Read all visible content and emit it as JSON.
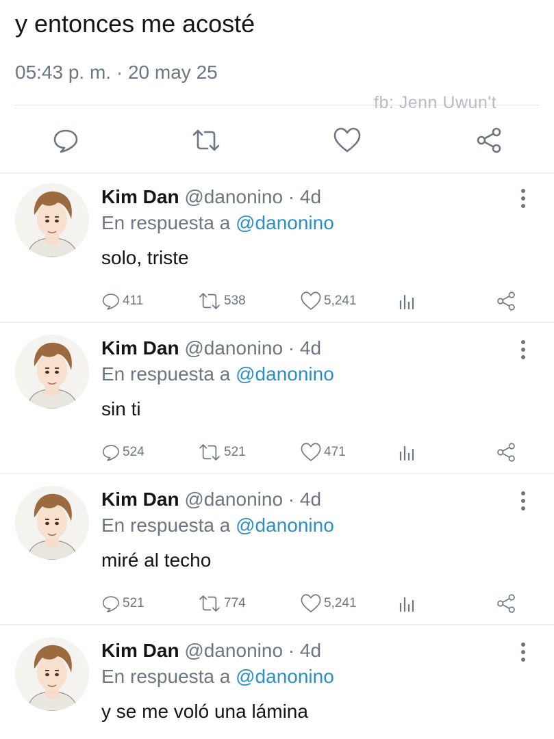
{
  "tweet": {
    "text": "y entonces me acosté",
    "meta": "05:43 p. m. · 20 may 25",
    "watermark": "fb: Jenn Uwun't",
    "actions": [
      "reply-icon",
      "retweet-icon",
      "like-icon",
      "share-icon"
    ]
  },
  "replies": [
    {
      "name": "Kim Dan",
      "handle": "@danonino · 4d",
      "reply_prefix": "En respuesta a ",
      "reply_mention": "@danonino",
      "text": "solo, triste",
      "replies": "411",
      "retweets": "538",
      "likes": "5,241"
    },
    {
      "name": "Kim Dan",
      "handle": "@danonino · 4d",
      "reply_prefix": "En respuesta a ",
      "reply_mention": "@danonino",
      "text": "sin ti",
      "replies": "524",
      "retweets": "521",
      "likes": "471"
    },
    {
      "name": "Kim Dan",
      "handle": "@danonino · 4d",
      "reply_prefix": "En respuesta a ",
      "reply_mention": "@danonino",
      "text": "miré al techo",
      "replies": "521",
      "retweets": "774",
      "likes": "5,241"
    },
    {
      "name": "Kim Dan",
      "handle": "@danonino · 4d",
      "reply_prefix": "En respuesta a ",
      "reply_mention": "@danonino",
      "text": "y se me voló una lámina"
    }
  ],
  "colors": {
    "text": "#141414",
    "muted": "#6b7680",
    "mention": "#2a8fc7",
    "divider": "#dfe3e6"
  }
}
